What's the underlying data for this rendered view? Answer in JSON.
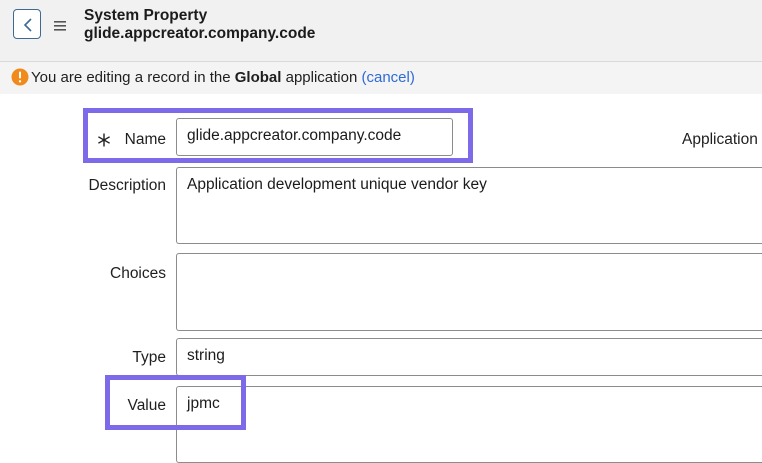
{
  "header": {
    "title": "System Property",
    "subtitle": "glide.appcreator.company.code"
  },
  "notice": {
    "prefix": "You are editing a record in the ",
    "scope": "Global",
    "suffix": " application ",
    "cancel_link": "(cancel)"
  },
  "form": {
    "name_label": "Name",
    "name_value": "glide.appcreator.company.code",
    "application_label": "Application",
    "description_label": "Description",
    "description_value": "Application development unique vendor key",
    "choices_label": "Choices",
    "choices_value": "",
    "type_label": "Type",
    "type_value": "string",
    "value_label": "Value",
    "value_value": "jpmc"
  },
  "colors": {
    "highlight": "#7d6ae8",
    "link": "#2f6bd4",
    "warning": "#f08a1c"
  },
  "icons": [
    "back-arrow-icon",
    "hamburger-menu-icon",
    "warning-icon",
    "required-asterisk-icon"
  ]
}
